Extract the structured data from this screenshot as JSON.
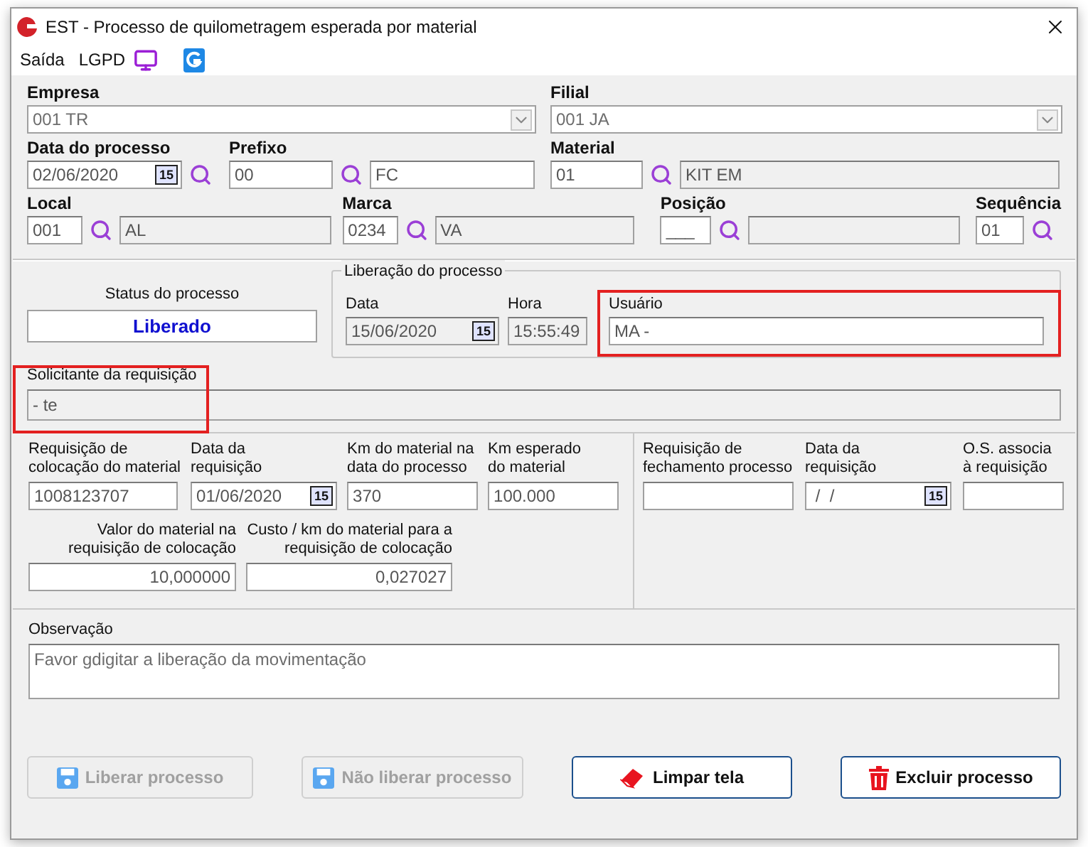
{
  "window": {
    "title": "EST - Processo de quilometragem esperada por material"
  },
  "menu": [
    {
      "kind": "text",
      "label": "Saída"
    },
    {
      "kind": "text",
      "label": "LGPD"
    },
    {
      "kind": "monitor"
    },
    {
      "kind": "logo"
    }
  ],
  "empresa": {
    "label": "Empresa",
    "value": "001 TR"
  },
  "filial": {
    "label": "Filial",
    "value": "001 JA"
  },
  "data_processo": {
    "label": "Data do processo",
    "value": "02/06/2020",
    "calendar": "15"
  },
  "prefixo": {
    "label": "Prefixo",
    "code": {
      "value": "00",
      "disabled": false
    },
    "description": {
      "value": "FC",
      "disabled": false
    }
  },
  "material": {
    "label": "Material",
    "code": {
      "value": "01",
      "disabled": false
    },
    "description": {
      "value": "KIT EM",
      "disabled": true
    }
  },
  "local": {
    "label": "Local",
    "code": {
      "value": "001",
      "disabled": false
    },
    "description": {
      "value": "AL",
      "disabled": true
    }
  },
  "marca": {
    "label": "Marca",
    "code": {
      "value": "0234",
      "disabled": false
    },
    "description": {
      "value": "VA",
      "disabled": true
    }
  },
  "posicao": {
    "label": "Posição",
    "code": {
      "value": "___",
      "disabled": false
    },
    "description": {
      "disabled": true
    }
  },
  "sequencia": {
    "label": "Sequência",
    "code": {
      "value": "01",
      "disabled": false
    }
  },
  "status": {
    "label": "Status do processo",
    "value": "Liberado"
  },
  "liberacao": {
    "title": "Liberação do processo",
    "data": {
      "label": "Data",
      "value": "15/06/2020",
      "disabled": true,
      "calendar": "15"
    },
    "hora": {
      "label": "Hora",
      "value": "15:55:49",
      "disabled": true
    },
    "usuario": {
      "label": "Usuário",
      "value": "MA -",
      "disabled": false,
      "highlighted": true
    }
  },
  "solicitante": {
    "label": "Solicitante da requisição",
    "value": "- te",
    "disabled": true,
    "highlighted": true
  },
  "colocacao": [
    {
      "label": "Requisição de\ncolocação do material",
      "value": "1008123707"
    },
    {
      "label": "Data da\nrequisição",
      "value": "01/06/2020",
      "calendar": "15"
    },
    {
      "label": "Km do material na\ndata do processo",
      "value": "370"
    },
    {
      "label": "Km esperado\ndo material",
      "value": "100.000"
    }
  ],
  "valores": [
    {
      "label": "Valor do material na\nrequisição de colocação",
      "value": "10,000000"
    },
    {
      "label": "Custo / km do material para a\nrequisição de colocação",
      "value": "0,027027"
    }
  ],
  "fechamento": [
    {
      "label": "Requisição de\nfechamento processo"
    },
    {
      "label": "Data da\nrequisição",
      "value": " /  /",
      "calendar": "15"
    },
    {
      "label": "O.S. associa\nà requisição"
    }
  ],
  "observacao": {
    "label": "Observação",
    "value": "Favor gdigitar a liberação da movimentação"
  },
  "buttons": [
    {
      "label": "Liberar processo",
      "kind": "save",
      "disabled": true
    },
    {
      "label": "Não liberar processo",
      "kind": "save",
      "disabled": true
    },
    {
      "label": "Limpar tela",
      "kind": "eraser",
      "disabled": false
    },
    {
      "label": "Excluir processo",
      "kind": "trash",
      "disabled": false
    }
  ]
}
